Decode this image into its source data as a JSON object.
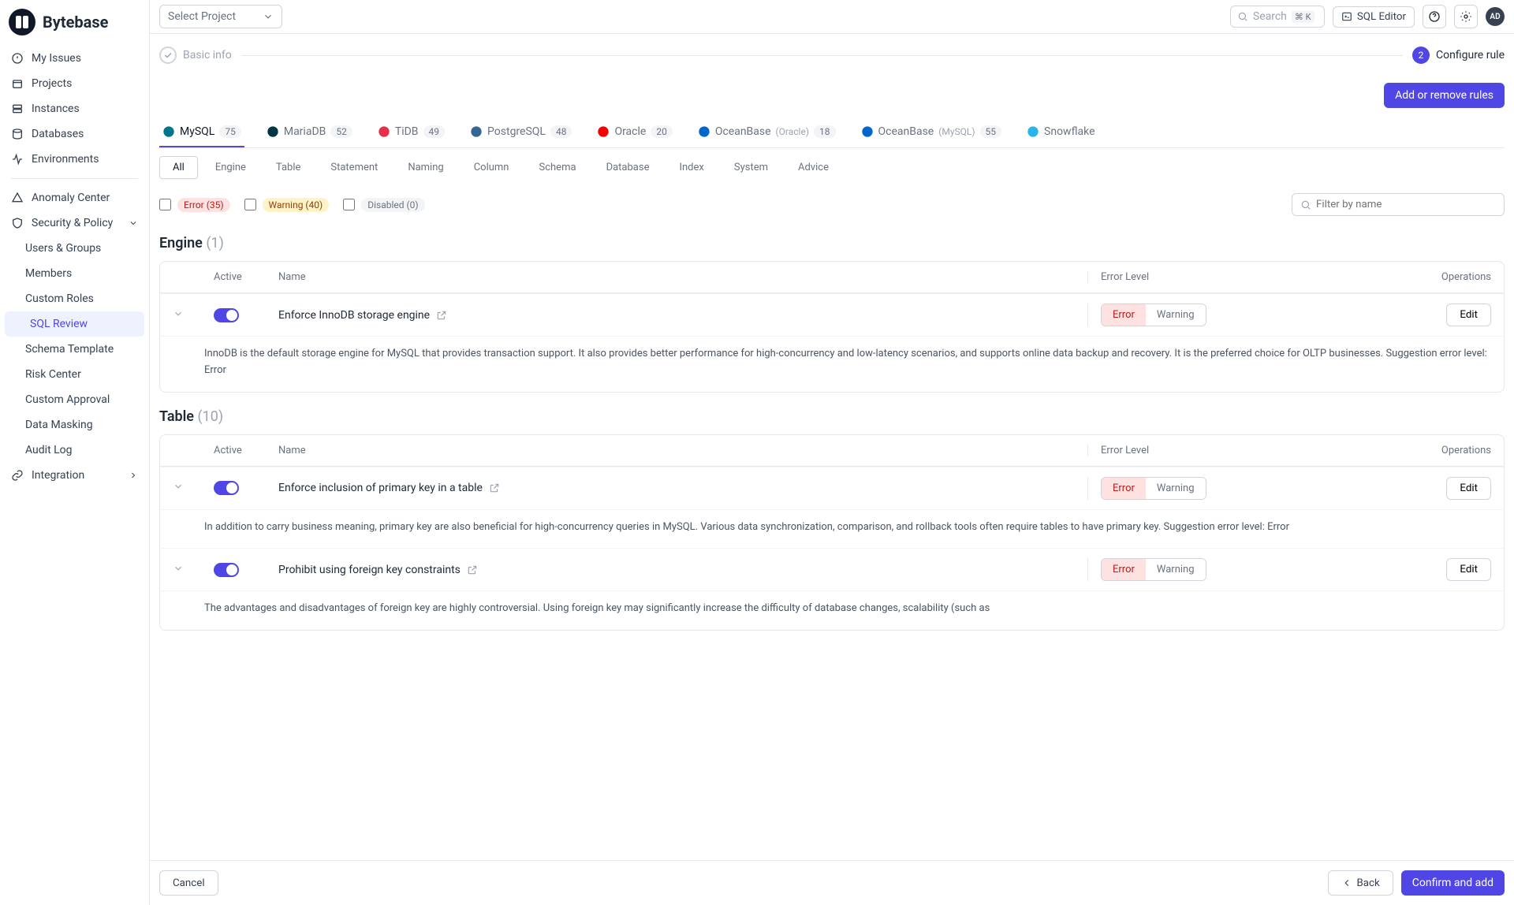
{
  "logo": "Bytebase",
  "nav": {
    "myIssues": "My Issues",
    "projects": "Projects",
    "instances": "Instances",
    "databases": "Databases",
    "environments": "Environments",
    "anomaly": "Anomaly Center",
    "security": "Security & Policy",
    "users": "Users & Groups",
    "members": "Members",
    "customRoles": "Custom Roles",
    "sqlReview": "SQL Review",
    "schemaTemplate": "Schema Template",
    "riskCenter": "Risk Center",
    "customApproval": "Custom Approval",
    "dataMasking": "Data Masking",
    "auditLog": "Audit Log",
    "integration": "Integration"
  },
  "topbar": {
    "selectProject": "Select Project",
    "search": "Search",
    "kbd": "⌘ K",
    "sqlEditor": "SQL Editor",
    "avatar": "AD"
  },
  "stepper": {
    "step1": "Basic info",
    "step2num": "2",
    "step2": "Configure rule"
  },
  "addRules": "Add or remove rules",
  "dbTabs": [
    {
      "name": "MySQL",
      "count": "75"
    },
    {
      "name": "MariaDB",
      "count": "52"
    },
    {
      "name": "TiDB",
      "count": "49"
    },
    {
      "name": "PostgreSQL",
      "count": "48"
    },
    {
      "name": "Oracle",
      "count": "20"
    },
    {
      "name": "OceanBase",
      "suffix": "(Oracle)",
      "count": "18"
    },
    {
      "name": "OceanBase",
      "suffix": "(MySQL)",
      "count": "55"
    },
    {
      "name": "Snowflake",
      "count": ""
    }
  ],
  "catTabs": [
    "All",
    "Engine",
    "Table",
    "Statement",
    "Naming",
    "Column",
    "Schema",
    "Database",
    "Index",
    "System",
    "Advice"
  ],
  "filters": {
    "error": "Error (35)",
    "warning": "Warning (40)",
    "disabled": "Disabled (0)",
    "placeholder": "Filter by name"
  },
  "headers": {
    "active": "Active",
    "name": "Name",
    "errorLevel": "Error Level",
    "operations": "Operations"
  },
  "level": {
    "error": "Error",
    "warning": "Warning"
  },
  "editLabel": "Edit",
  "sections": [
    {
      "title": "Engine",
      "count": "(1)",
      "rules": [
        {
          "name": "Enforce InnoDB storage engine",
          "desc": "InnoDB is the default storage engine for MySQL that provides transaction support. It also provides better performance for high-concurrency and low-latency scenarios, and supports online data backup and recovery. It is the preferred choice for OLTP businesses. Suggestion error level: Error"
        }
      ]
    },
    {
      "title": "Table",
      "count": "(10)",
      "rules": [
        {
          "name": "Enforce inclusion of primary key in a table",
          "desc": "In addition to carry business meaning, primary key are also beneficial for high-concurrency queries in MySQL. Various data synchronization, comparison, and rollback tools often require tables to have primary key. Suggestion error level: Error"
        },
        {
          "name": "Prohibit using foreign key constraints",
          "desc": "The advantages and disadvantages of foreign key are highly controversial. Using foreign key may significantly increase the difficulty of database changes, scalability (such as"
        }
      ]
    }
  ],
  "footer": {
    "cancel": "Cancel",
    "back": "Back",
    "confirm": "Confirm and add"
  }
}
